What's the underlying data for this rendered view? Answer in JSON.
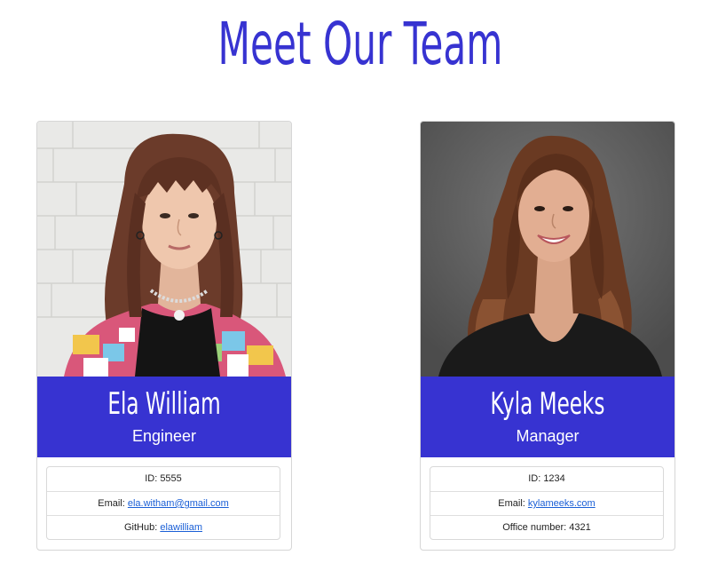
{
  "page": {
    "title": "Meet Our Team"
  },
  "colors": {
    "accent": "#3733d1",
    "link": "#1a5fd6"
  },
  "team": [
    {
      "name": "Ela William",
      "role": "Engineer",
      "id_label": "ID: ",
      "id": "5555",
      "email_label": "Email: ",
      "email": "ela.witham@gmail.com",
      "extra_label": "GitHub: ",
      "extra_value": "elawilliam"
    },
    {
      "name": "Kyla Meeks",
      "role": "Manager",
      "id_label": "ID: ",
      "id": "1234",
      "email_label": "Email: ",
      "email": "kylameeks.com",
      "extra_label": "Office number: ",
      "extra_value": "4321"
    }
  ]
}
